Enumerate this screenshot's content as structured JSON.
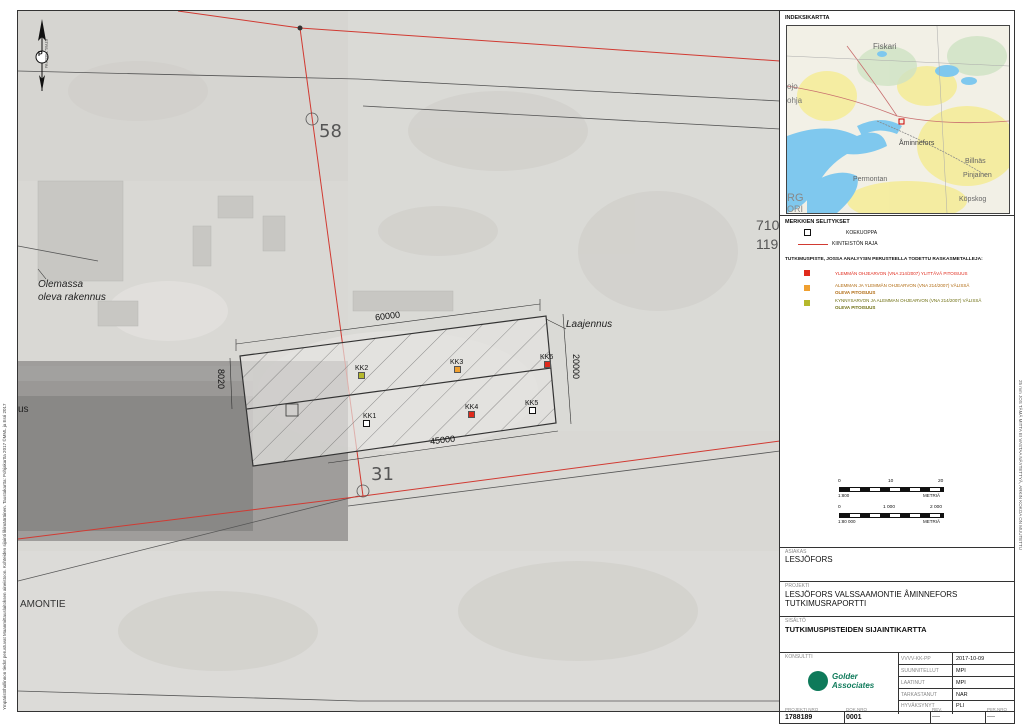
{
  "map": {
    "north_label": "P",
    "north_sublabel": "ETRS-TM35FIN",
    "parcel_numbers": [
      "58",
      "31",
      "710",
      "119"
    ],
    "road_label": "AMONTIE",
    "building_label_1": "Olemassa",
    "building_label_2": "oleva rakennus",
    "building_label_left": "us",
    "extension_label": "Laajennus",
    "dimensions": [
      "60000",
      "8020",
      "20000",
      "45000"
    ],
    "sample_points": [
      {
        "id": "KK1",
        "class": "koekuoppa",
        "color": "#ffffff"
      },
      {
        "id": "KK2",
        "class": "kynnysarvo",
        "color": "#b5b82c"
      },
      {
        "id": "KK3",
        "class": "alempi",
        "color": "#f0a030"
      },
      {
        "id": "KK4",
        "class": "ylempi",
        "color": "#e02a1c"
      },
      {
        "id": "KK5",
        "class": "koekuoppa",
        "color": "#ffffff"
      },
      {
        "id": "KK6",
        "class": "ylempi",
        "color": "#e02a1c"
      }
    ],
    "property_line_color": "#d13a32"
  },
  "side_strip_text": "Ympäristöhallinnon tiedot perustuvat Maanmittauslaitoksen aineistoon. Kohteiden sijainti likimääräinen. Taustakartta: Pohjakartta 2017 ©MML ja Esri 2017",
  "index_map": {
    "title": "INDEKSIKARTTA",
    "places": [
      "Fiskari",
      "Åminnefors",
      "Billnäs",
      "Pinjainen",
      "Permontan",
      "Köpskog",
      "ojo",
      "ohja",
      "RG",
      "ORI"
    ]
  },
  "legend": {
    "title": "MERKKIEN SELITYKSET",
    "koekuoppa": "KOEKUOPPA",
    "kiinteiston_raja": "KIINTEISTÖN RAJA",
    "section_title": "TUTKIMUSPISTE, JOSSA ANALYYSIN PERUSTEELLA TODETTU RASKASMETALLEJA:",
    "items": [
      {
        "line1": "YLEMMÄN OHJEARVON (VNA 214/2007) YLITTÄVÄ PITOISUUS",
        "line2": "",
        "color": "#e02a1c"
      },
      {
        "line1": "ALEMMAN JA YLEMMÄN OHJEARVON (VNA 214/2007) VÄLISSÄ",
        "line2": "OLEVA PITOISUUS",
        "color": "#f0a030"
      },
      {
        "line1": "KYNNYSARVON JA ALEMMAN OHJEARVON (VNA 214/2007) VÄLISSÄ",
        "line2": "OLEVA PITOISUUS",
        "color": "#b5b82c"
      }
    ]
  },
  "scales": {
    "scale1_ticks": [
      "0",
      "10",
      "20"
    ],
    "scale1_ratio": "1:800",
    "scale1_unit": "METRIÄ",
    "scale2_ticks": [
      "0",
      "1 000",
      "2 000"
    ],
    "scale2_ratio": "1:80 000",
    "scale2_unit": "METRIÄ"
  },
  "titleblock": {
    "asiakas_label": "ASIAKAS",
    "asiakas": "LESJÖFORS",
    "projekti_label": "PROJEKTI",
    "projekti_1": "LESJÖFORS VALSSAAMONTIE ÅMINNEFORS",
    "projekti_2": "TUTKIMUSRAPORTTI",
    "sisalto_label": "SISÄLTÖ",
    "sisalto": "TUTKIMUSPISTEIDEN SIJAINTIKARTTA",
    "konsultti_label": "KONSULTTI",
    "logo_line1": "Golder",
    "logo_line2": "Associates",
    "rows": [
      {
        "label": "VVVV-KK-PP",
        "value": "2017-10-09"
      },
      {
        "label": "SUUNNITELLUT",
        "value": "MPI"
      },
      {
        "label": "LAATINUT",
        "value": "MPI"
      },
      {
        "label": "TARKASTANUT",
        "value": "NAR"
      },
      {
        "label": "HYVÄKSYNYT",
        "value": "PLI"
      }
    ],
    "projekti_nro_label": "PROJEKTI NRO",
    "projekti_nro": "1788189",
    "dok_nro_label": "DOK.NRO",
    "dok_nro": "0001",
    "rev_label": "REV.",
    "rev": "----",
    "piir_label": "PIIR.NRO",
    "piir": "----"
  },
  "right_strip_text": "25 mm  JOS TÄMÄ MITTA EI VASTAA NÄYTETTYÄ, ARKIN KOKOA ON MUUTETTU"
}
